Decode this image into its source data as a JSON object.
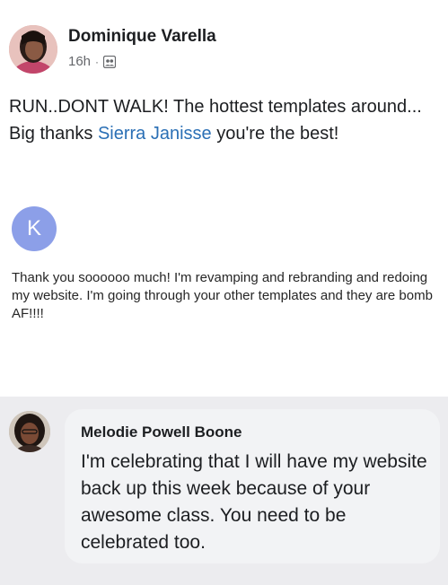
{
  "post": {
    "author": "Dominique Varella",
    "time": "16h",
    "separator": "·",
    "audience_icon": "friends-icon",
    "text_before": "RUN..DONT WALK! The hottest templates around... Big thanks ",
    "mention": "Sierra Janisse",
    "text_after": " you're the best!",
    "mention_color": "#2a6fb5"
  },
  "email": {
    "avatar_letter": "K",
    "avatar_color": "#8c9fe8",
    "body": "Thank you soooooo much!  I'm revamping and rebranding and redoing my website.  I'm going through your other templates and they are bomb AF!!!!"
  },
  "comment": {
    "author": "Melodie Powell Boone",
    "text": "I'm celebrating that I will have my website back up this week because of your awesome class. You need to be celebrated too."
  }
}
